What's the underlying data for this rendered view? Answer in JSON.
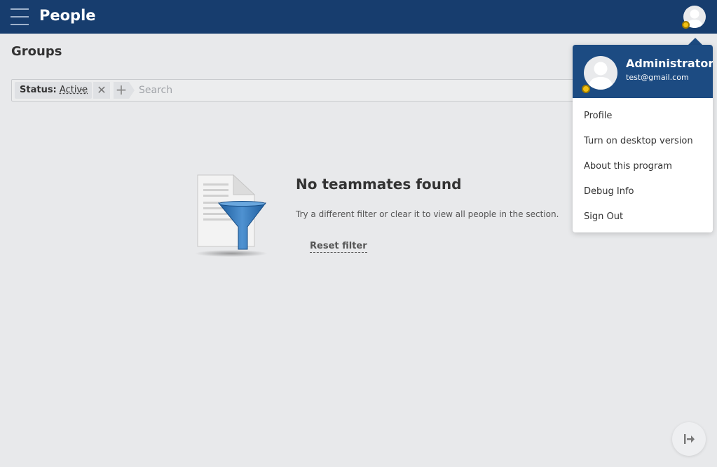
{
  "header": {
    "title": "People",
    "menu_icon": "hamburger-icon",
    "avatar_icon": "user-avatar-icon"
  },
  "page": {
    "title": "Groups"
  },
  "filter": {
    "chip_key": "Status:",
    "chip_value": "Active",
    "clear_symbol": "✕",
    "add_symbol": "+",
    "search_placeholder": "Search"
  },
  "empty_state": {
    "title": "No teammates found",
    "description": "Try a different filter or clear it to view all people in the section.",
    "reset_label": "Reset filter"
  },
  "user_menu": {
    "name": "Administrator",
    "email": "test@gmail.com",
    "items": [
      {
        "label": "Profile"
      },
      {
        "label": "Turn on desktop version"
      },
      {
        "label": "About this program"
      },
      {
        "label": "Debug Info"
      },
      {
        "label": "Sign Out"
      }
    ]
  },
  "colors": {
    "topbar": "#173d6e",
    "menu_header": "#1c4b82",
    "status_dot": "#f2c114",
    "background": "#e8e9eb"
  }
}
